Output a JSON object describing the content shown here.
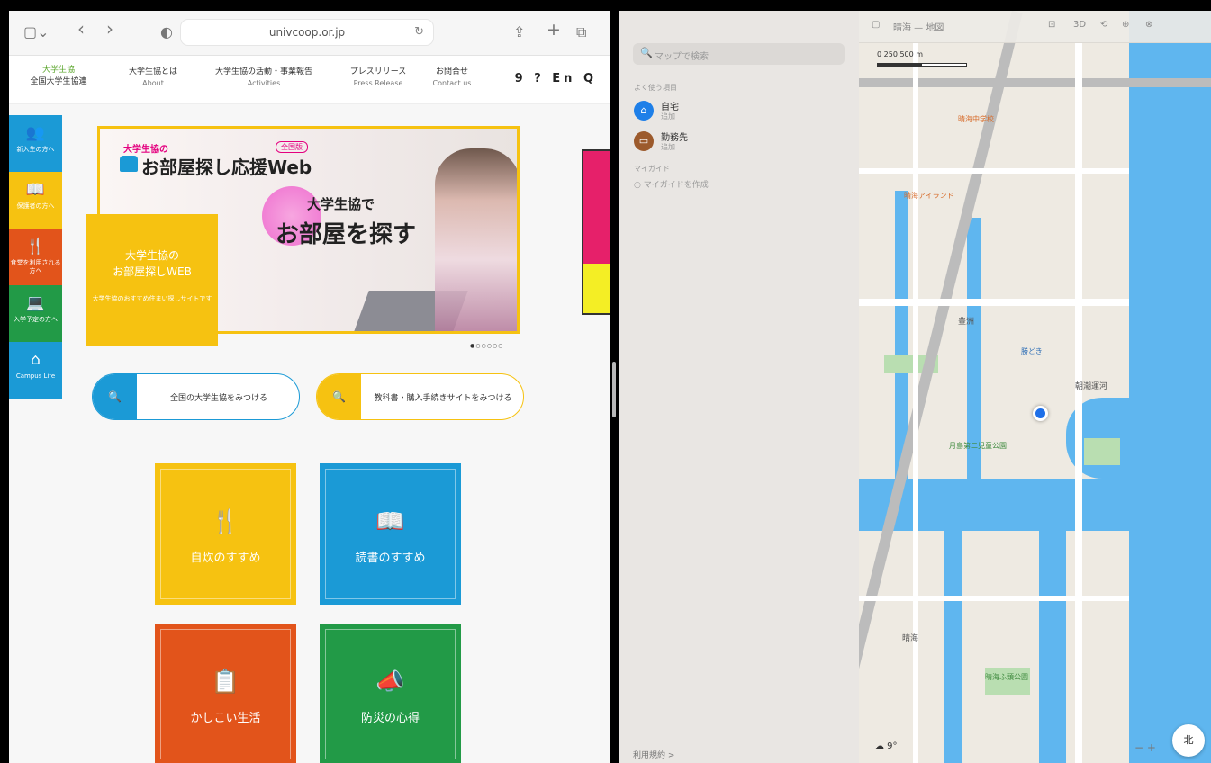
{
  "left": {
    "url": "univcoop.or.jp",
    "logo": {
      "line1": "大学生協",
      "line2": "全国大学生協連"
    },
    "nav": [
      {
        "jp": "大学生協とは",
        "en": "About"
      },
      {
        "jp": "大学生協の活動・事業報告",
        "en": "Activities"
      },
      {
        "jp": "プレスリリース",
        "en": "Press Release"
      },
      {
        "jp": "お問合せ",
        "en": "Contact us"
      }
    ],
    "header_icons": "9 ? En Q",
    "sidebar": [
      {
        "label": "新入生の方へ",
        "color": "#1b9ad6",
        "icon": "people-icon"
      },
      {
        "label": "保護者の方へ",
        "color": "#f6c211",
        "icon": "book-icon"
      },
      {
        "label": "食堂を利用される方へ",
        "color": "#e2541b",
        "icon": "dining-icon"
      },
      {
        "label": "入学予定の方へ",
        "color": "#229a47",
        "icon": "laptop-house-icon"
      },
      {
        "label": "Campus Life",
        "color": "#1b9ad6",
        "icon": "house-icon"
      }
    ],
    "hero": {
      "tag": "大学生協の",
      "badge": "全国版",
      "title": "お部屋探し応援Web",
      "sub1": "大学生協で",
      "sub2": "お部屋を探す"
    },
    "yellow_box": {
      "line1": "大学生協の",
      "line2": "お部屋探しWEB",
      "line3": "大学生協のおすすめ住まい探しサイトです"
    },
    "dots": "●○○○○○",
    "search1": "全国の大学生協をみつける",
    "search2": "教科書・購入手続きサイトをみつける",
    "tiles": [
      {
        "label": "自炊のすすめ",
        "color": "#f6c211",
        "icon": "fork-knife-icon"
      },
      {
        "label": "読書のすすめ",
        "color": "#1b9ad6",
        "icon": "reading-icon"
      },
      {
        "label": "かしこい生活",
        "color": "#e2541b",
        "icon": "clipboard-check-icon"
      },
      {
        "label": "防災の心得",
        "color": "#229a47",
        "icon": "megaphone-icon"
      }
    ]
  },
  "maps": {
    "search_placeholder": "マップで検索",
    "favorites_title": "よく使う項目",
    "favorites": [
      {
        "name": "自宅",
        "sub": "追加",
        "color": "#1e7fe8"
      },
      {
        "name": "勤務先",
        "sub": "追加",
        "color": "#9c5a2c"
      }
    ],
    "guides_title": "マイガイド",
    "recents": "マイガイドを作成",
    "terms": "利用規約 >",
    "map_title": "晴海 — 地図",
    "toolbar_items": [
      "3D",
      "⟲",
      "⊕",
      "⊗"
    ],
    "scale_labels": "0      250      500 m",
    "weather": "☁ 9°",
    "compass": "北",
    "labels": [
      {
        "t": "晴海中学校",
        "c": "poi"
      },
      {
        "t": "晴海アイランド",
        "c": "poi"
      },
      {
        "t": "月島第二児童公園",
        "c": "poig"
      },
      {
        "t": "豊洲",
        "c": "mlabel"
      },
      {
        "t": "勝どき",
        "c": "poib"
      },
      {
        "t": "晴海",
        "c": "mlabel"
      },
      {
        "t": "朝潮運河",
        "c": "mlabel"
      },
      {
        "t": "晴海ふ頭公園",
        "c": "poig"
      }
    ]
  }
}
